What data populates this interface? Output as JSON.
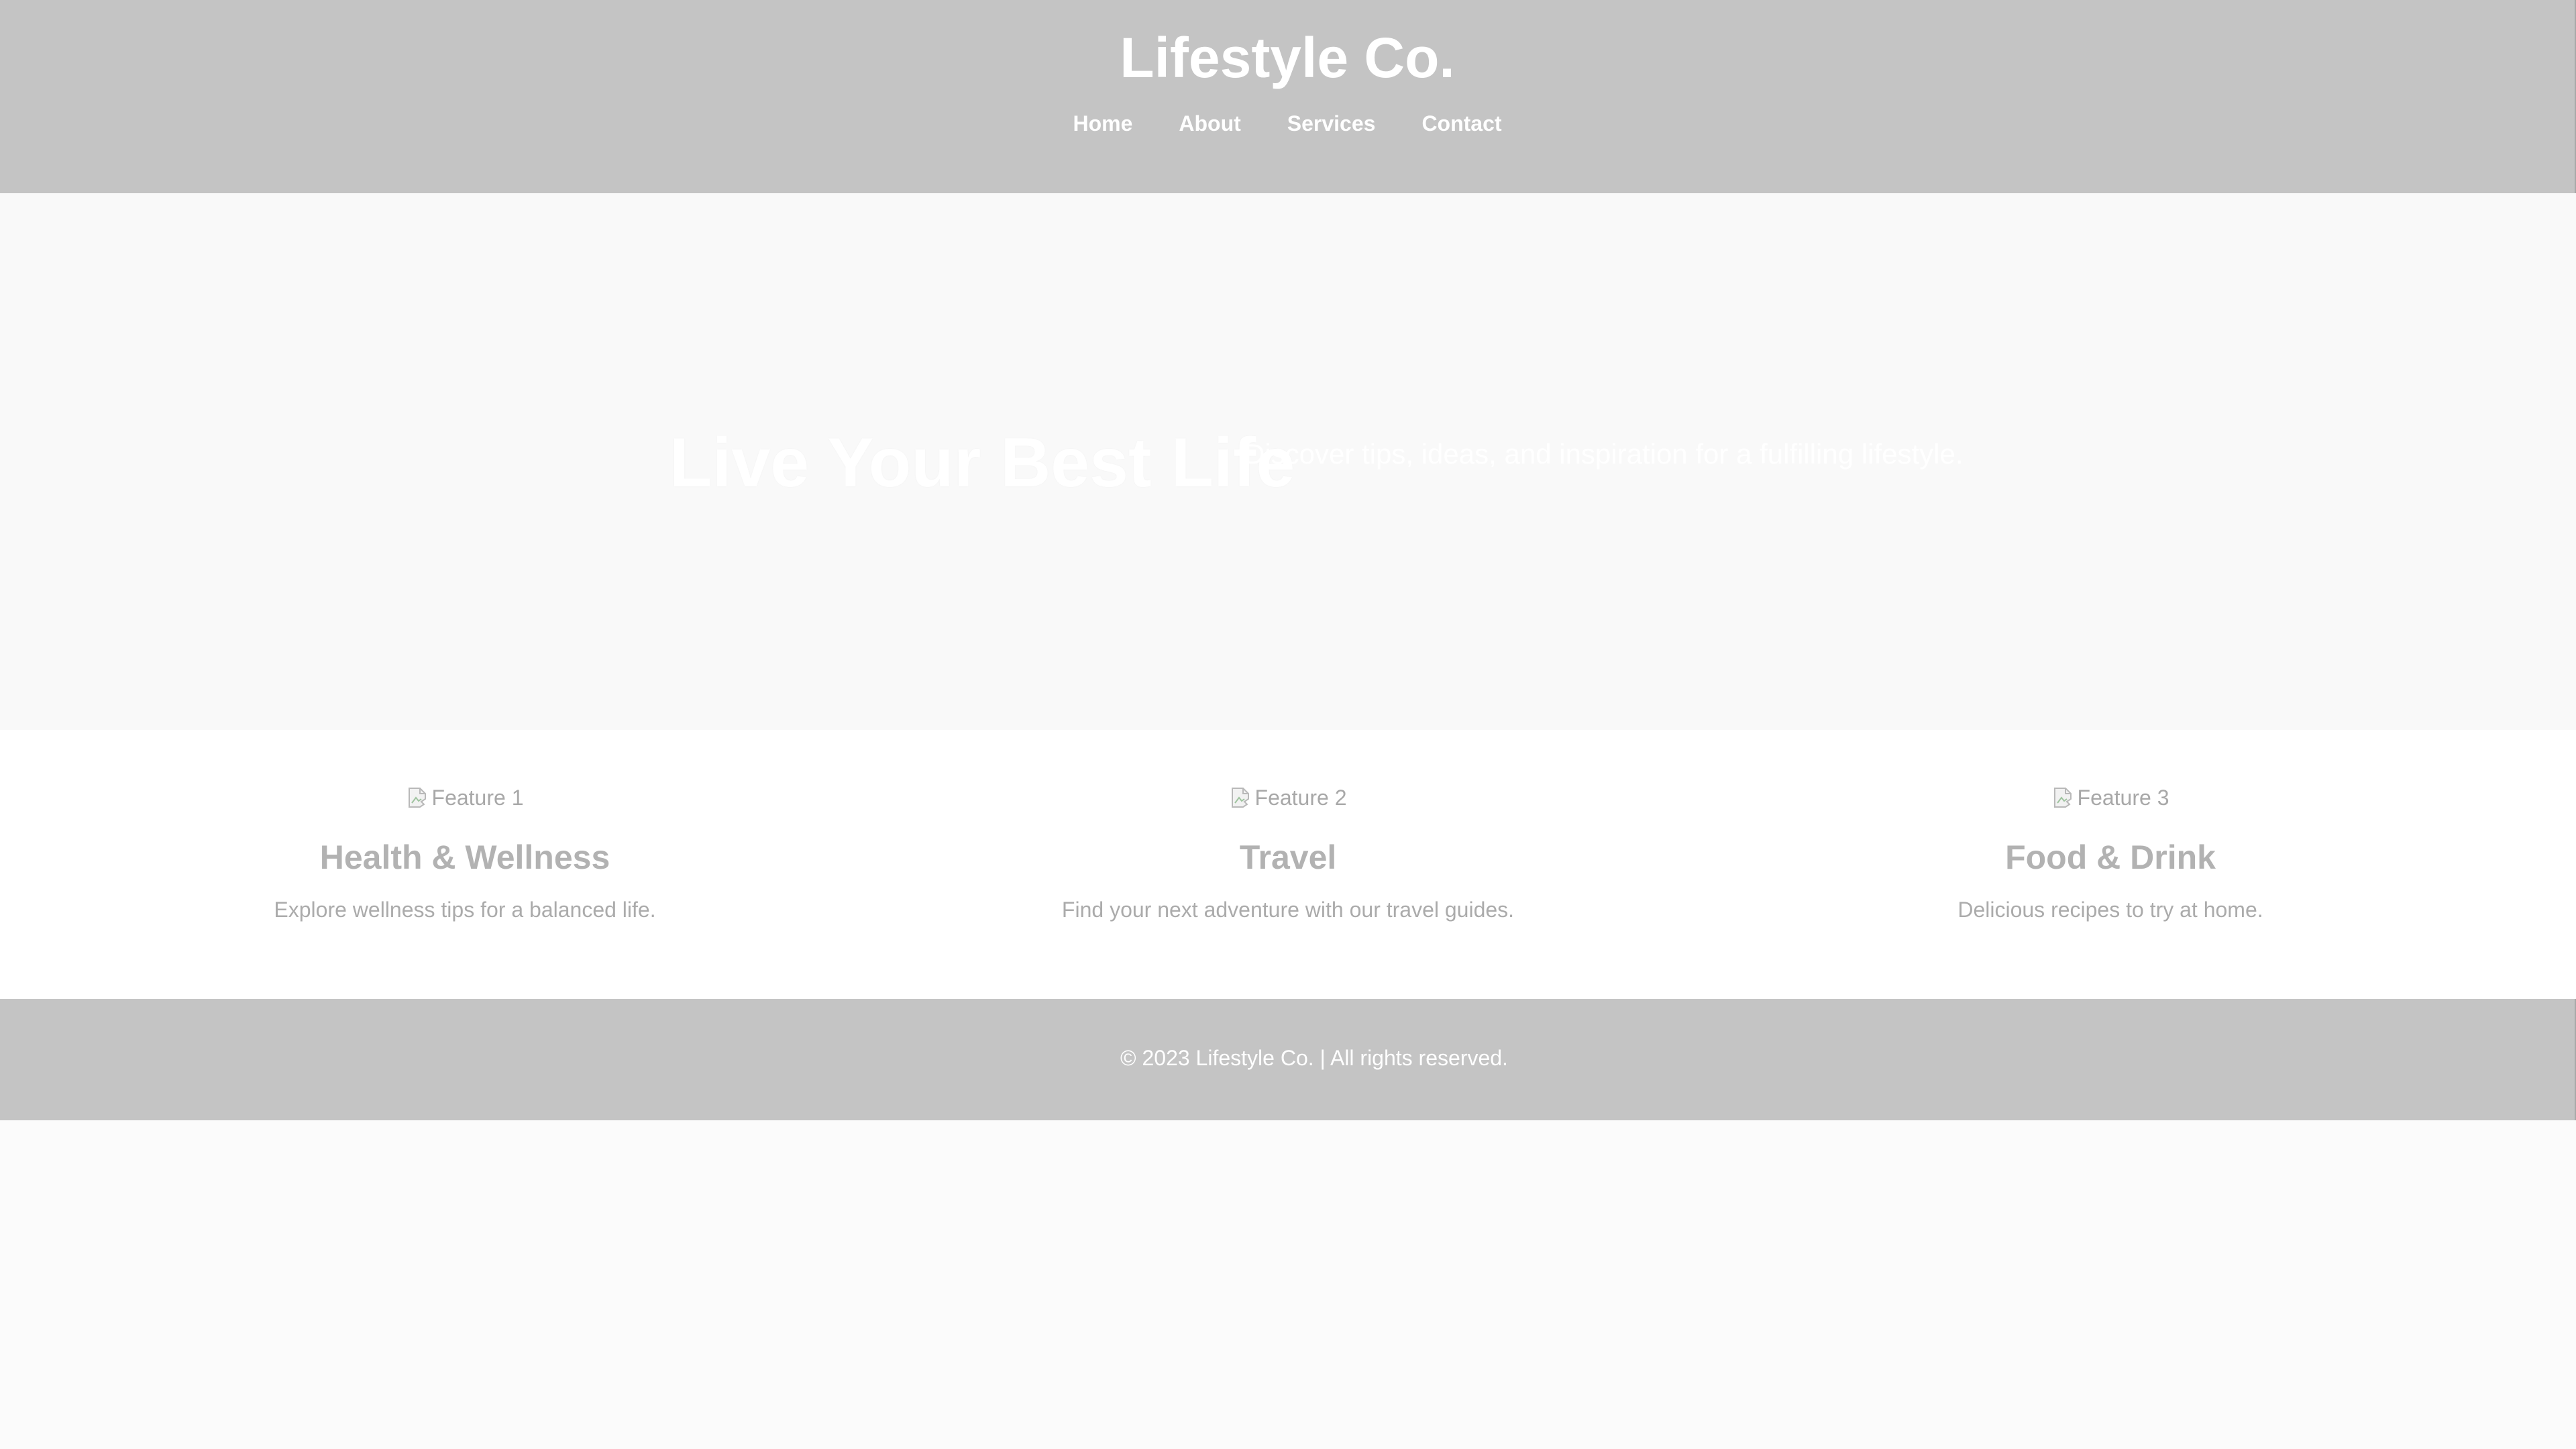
{
  "header": {
    "title": "Lifestyle Co.",
    "nav": [
      {
        "label": "Home"
      },
      {
        "label": "About"
      },
      {
        "label": "Services"
      },
      {
        "label": "Contact"
      }
    ]
  },
  "hero": {
    "title": "Live Your Best Life",
    "subtitle": "Discover tips, ideas, and inspiration for a fulfilling lifestyle."
  },
  "features": [
    {
      "image_alt": "Feature 1",
      "title": "Health & Wellness",
      "text": "Explore wellness tips for a balanced life."
    },
    {
      "image_alt": "Feature 2",
      "title": "Travel",
      "text": "Find your next adventure with our travel guides."
    },
    {
      "image_alt": "Feature 3",
      "title": "Food & Drink",
      "text": "Delicious recipes to try at home."
    }
  ],
  "footer": {
    "text": "© 2023 Lifestyle Co. | All rights reserved."
  },
  "colors": {
    "header_bg": "#c4c4c4",
    "page_bg": "#fbfbfb",
    "feature_title": "#b2b2b2",
    "feature_text": "#ababab"
  }
}
